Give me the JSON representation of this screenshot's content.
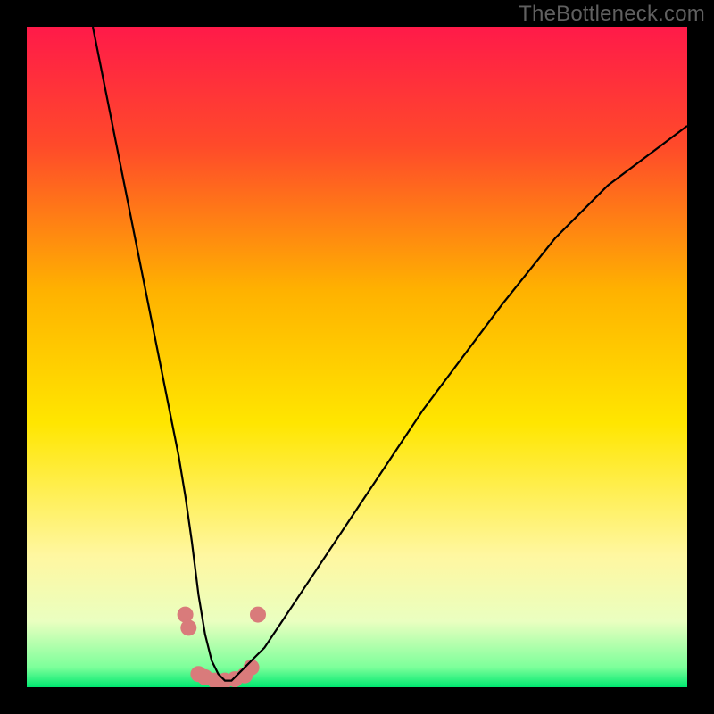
{
  "watermark": "TheBottleneck.com",
  "chart_data": {
    "type": "line",
    "title": "",
    "xlabel": "",
    "ylabel": "",
    "xlim": [
      0,
      100
    ],
    "ylim": [
      0,
      100
    ],
    "gradient_stops": [
      {
        "pct": 0,
        "color": "#ff1a49"
      },
      {
        "pct": 18,
        "color": "#ff4a2a"
      },
      {
        "pct": 40,
        "color": "#ffb200"
      },
      {
        "pct": 60,
        "color": "#ffe600"
      },
      {
        "pct": 80,
        "color": "#fff7a0"
      },
      {
        "pct": 90,
        "color": "#eaffc0"
      },
      {
        "pct": 97,
        "color": "#7cff9a"
      },
      {
        "pct": 100,
        "color": "#00e870"
      }
    ],
    "series": [
      {
        "name": "bottleneck-curve",
        "color": "#000000",
        "stroke_width": 2.2,
        "x": [
          10,
          12,
          14,
          16,
          18,
          20,
          22,
          23,
          24,
          25,
          26,
          27,
          28,
          29,
          30,
          31,
          32,
          33,
          34,
          36,
          38,
          40,
          44,
          48,
          52,
          56,
          60,
          66,
          72,
          80,
          88,
          96,
          100
        ],
        "y": [
          100,
          90,
          80,
          70,
          60,
          50,
          40,
          35,
          29,
          22,
          14,
          8,
          4,
          2,
          1,
          1,
          2,
          3,
          4,
          6,
          9,
          12,
          18,
          24,
          30,
          36,
          42,
          50,
          58,
          68,
          76,
          82,
          85
        ]
      }
    ],
    "markers": {
      "name": "highlight-dots",
      "color": "#d97b7b",
      "radius": 9,
      "points": [
        {
          "x": 24.0,
          "y": 11
        },
        {
          "x": 24.5,
          "y": 9
        },
        {
          "x": 26.0,
          "y": 2
        },
        {
          "x": 27.0,
          "y": 1.5
        },
        {
          "x": 28.5,
          "y": 1
        },
        {
          "x": 30.0,
          "y": 1
        },
        {
          "x": 31.5,
          "y": 1.2
        },
        {
          "x": 33.0,
          "y": 1.8
        },
        {
          "x": 34.0,
          "y": 3
        },
        {
          "x": 35.0,
          "y": 11
        }
      ]
    }
  }
}
